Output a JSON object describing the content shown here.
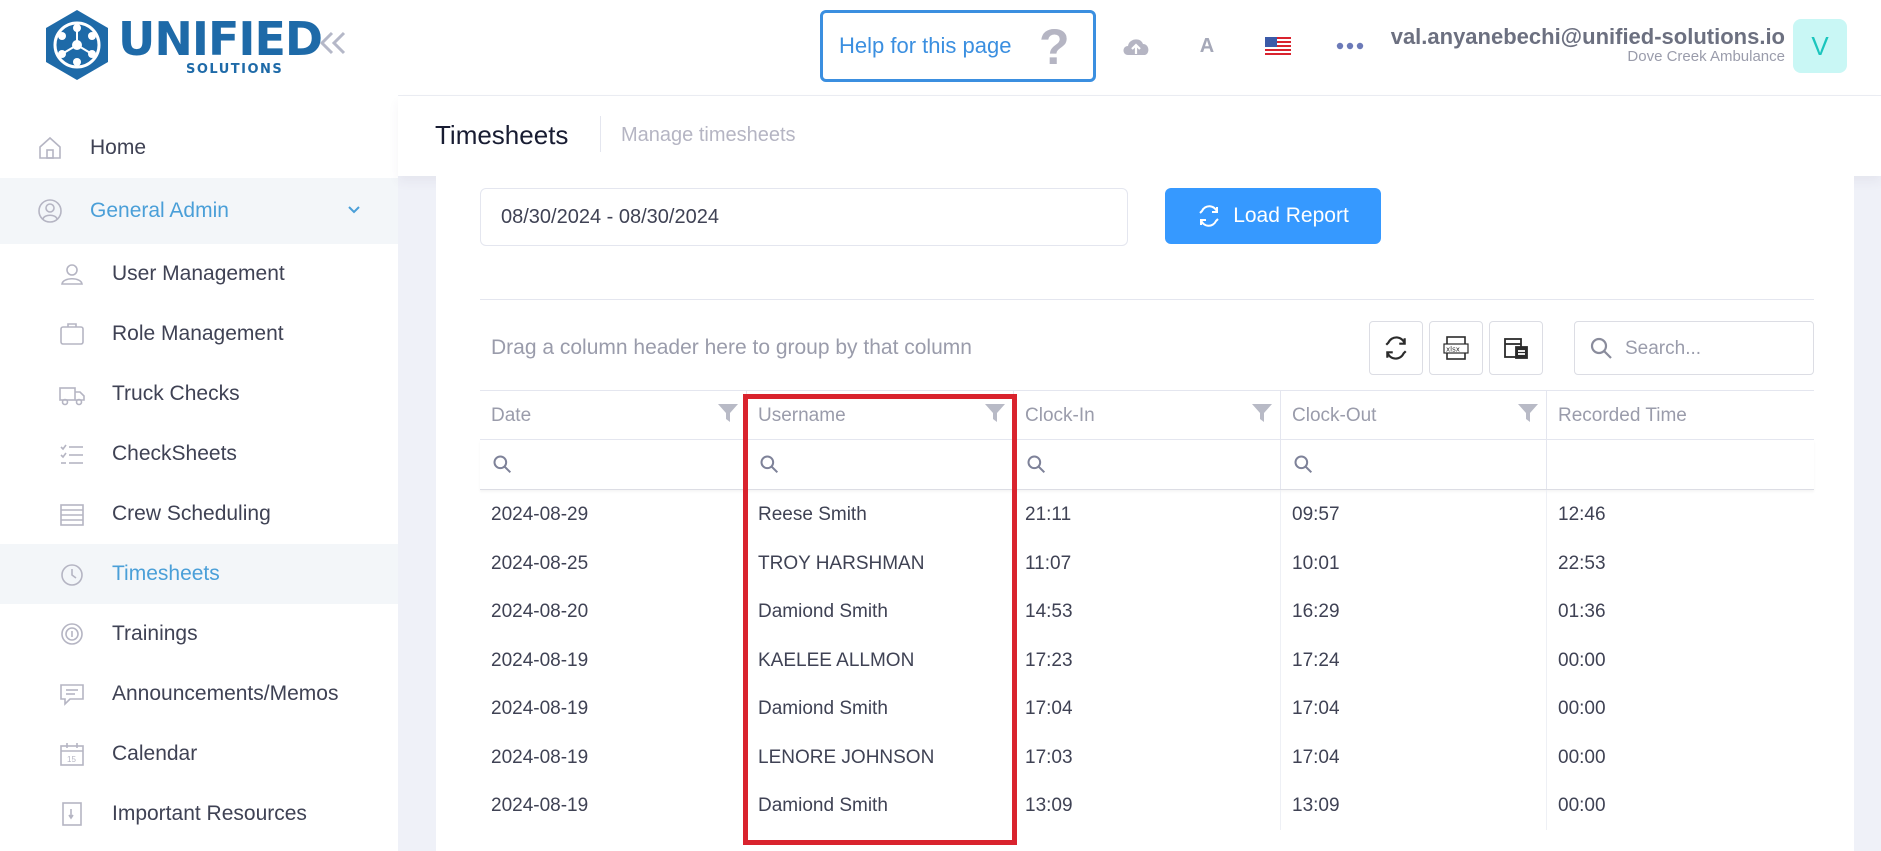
{
  "brand": {
    "name": "UNIFIED",
    "tagline": "SOLUTIONS"
  },
  "sidebar": {
    "items": [
      {
        "label": "Home",
        "icon": "home-icon"
      },
      {
        "label": "General Admin",
        "icon": "admin-icon",
        "expanded": true
      },
      {
        "label": "User Management",
        "icon": "user-icon"
      },
      {
        "label": "Role Management",
        "icon": "role-icon"
      },
      {
        "label": "Truck Checks",
        "icon": "truck-icon"
      },
      {
        "label": "CheckSheets",
        "icon": "checklist-icon"
      },
      {
        "label": "Crew Scheduling",
        "icon": "schedule-icon"
      },
      {
        "label": "Timesheets",
        "icon": "clock-icon",
        "active": true
      },
      {
        "label": "Trainings",
        "icon": "training-icon"
      },
      {
        "label": "Announcements/Memos",
        "icon": "memo-icon"
      },
      {
        "label": "Calendar",
        "icon": "calendar-icon"
      },
      {
        "label": "Important Resources",
        "icon": "resources-icon"
      }
    ]
  },
  "header": {
    "help_label": "Help for this page",
    "help_icon": "?",
    "font_toggle": "A",
    "user_email": "val.anyanebechi@unified-solutions.io",
    "user_org": "Dove Creek Ambulance",
    "avatar_letter": "V"
  },
  "subheader": {
    "title": "Timesheets",
    "subtitle": "Manage timesheets"
  },
  "report": {
    "date_range": "08/30/2024 - 08/30/2024",
    "load_label": "Load Report"
  },
  "grid": {
    "group_panel_text": "Drag a column header here to group by that column",
    "search_placeholder": "Search...",
    "columns": [
      "Date",
      "Username",
      "Clock-In",
      "Clock-Out",
      "Recorded Time"
    ],
    "rows": [
      [
        "2024-08-29",
        "Reese Smith",
        "21:11",
        "09:57",
        "12:46"
      ],
      [
        "2024-08-25",
        "TROY HARSHMAN",
        "11:07",
        "10:01",
        "22:53"
      ],
      [
        "2024-08-20",
        "Damiond Smith",
        "14:53",
        "16:29",
        "01:36"
      ],
      [
        "2024-08-19",
        "KAELEE ALLMON",
        "17:23",
        "17:24",
        "00:00"
      ],
      [
        "2024-08-19",
        "Damiond Smith",
        "17:04",
        "17:04",
        "00:00"
      ],
      [
        "2024-08-19",
        "LENORE JOHNSON",
        "17:03",
        "17:04",
        "00:00"
      ],
      [
        "2024-08-19",
        "Damiond Smith",
        "13:09",
        "13:09",
        "00:00"
      ]
    ]
  },
  "colors": {
    "accent": "#3699ff",
    "brand": "#1e6aa8",
    "highlight": "#d9232e",
    "active_text": "#4a9fd8"
  }
}
